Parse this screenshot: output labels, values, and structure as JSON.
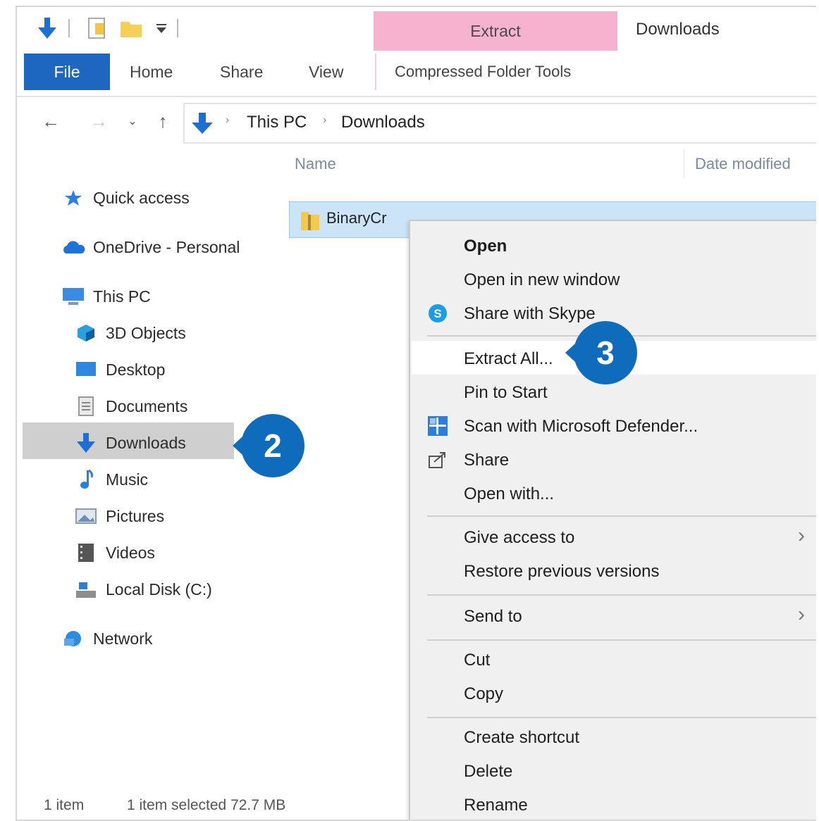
{
  "quick_access_toolbar": [
    "arrow-down-icon",
    "properties-icon",
    "new-folder-icon",
    "customize-toolbar-icon"
  ],
  "contextual_tab": "Extract",
  "window_title": "Downloads",
  "ribbon": {
    "file": "File",
    "home": "Home",
    "share": "Share",
    "view": "View",
    "compressed_tools": "Compressed Folder Tools"
  },
  "nav_buttons": {
    "back": "←",
    "forward": "→",
    "recent": "⌄",
    "up": "↑"
  },
  "breadcrumb": {
    "root": "This PC",
    "current": "Downloads",
    "separator": "›"
  },
  "navigation_pane": {
    "quick_access": "Quick access",
    "onedrive": "OneDrive - Personal",
    "this_pc": "This PC",
    "children": [
      "3D Objects",
      "Desktop",
      "Documents",
      "Downloads",
      "Music",
      "Pictures",
      "Videos",
      "Local Disk (C:)"
    ],
    "network": "Network"
  },
  "columns": {
    "name": "Name",
    "date_modified": "Date modified"
  },
  "file": {
    "name": "BinaryCr"
  },
  "status_bar": {
    "items": "1 item",
    "selected": "1 item selected  72.7 MB"
  },
  "context_menu": {
    "open": "Open",
    "open_new_window": "Open in new window",
    "share_skype": "Share with Skype",
    "extract_all": "Extract All...",
    "pin_start": "Pin to Start",
    "scan_defender": "Scan with Microsoft Defender...",
    "share": "Share",
    "open_with": "Open with...",
    "give_access": "Give access to",
    "restore_versions": "Restore previous versions",
    "send_to": "Send to",
    "cut": "Cut",
    "copy": "Copy",
    "create_shortcut": "Create shortcut",
    "delete": "Delete",
    "rename": "Rename",
    "submenu_arrow": "›"
  },
  "callouts": {
    "step2": "2",
    "step3": "3"
  },
  "colors": {
    "accent": "#1d67c1",
    "callout": "#0f6cbd",
    "contextual": "#f5b3cf",
    "selection": "#cce4f7"
  }
}
